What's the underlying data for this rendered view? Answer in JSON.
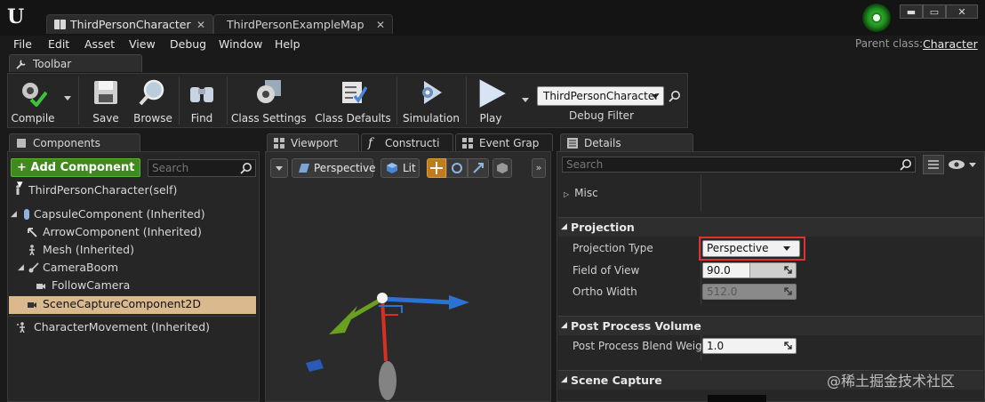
{
  "window": {
    "tabs": [
      {
        "label": "ThirdPersonCharacter",
        "active": true
      },
      {
        "label": "ThirdPersonExampleMap",
        "active": false
      }
    ],
    "controls": {
      "minimize": "▬",
      "maximize": "▭",
      "close": "✕"
    }
  },
  "menu": {
    "items": [
      "File",
      "Edit",
      "Asset",
      "View",
      "Debug",
      "Window",
      "Help"
    ],
    "parent_class_label": "Parent class:",
    "parent_class_value": "Character"
  },
  "toolbar": {
    "tab_label": "Toolbar",
    "buttons": [
      {
        "label": "Compile",
        "icon": "compile-gear-check-icon"
      },
      {
        "label": "Save",
        "icon": "save-disk-icon"
      },
      {
        "label": "Browse",
        "icon": "browse-magnifier-icon"
      },
      {
        "label": "Find",
        "icon": "find-binoculars-icon"
      },
      {
        "label": "Class Settings",
        "icon": "class-settings-gear-icon"
      },
      {
        "label": "Class Defaults",
        "icon": "class-defaults-checklist-icon"
      },
      {
        "label": "Simulation",
        "icon": "simulation-icon"
      },
      {
        "label": "Play",
        "icon": "play-triangle-icon"
      }
    ],
    "debug_filter": {
      "value": "ThirdPersonCharacter",
      "label": "Debug Filter"
    }
  },
  "components": {
    "tab_label": "Components",
    "add_button": "+ Add Component ▾",
    "search_placeholder": "Search",
    "tree": [
      {
        "label": "ThirdPersonCharacter(self)"
      },
      {
        "label": "CapsuleComponent (Inherited)"
      },
      {
        "label": "ArrowComponent (Inherited)"
      },
      {
        "label": "Mesh (Inherited)"
      },
      {
        "label": "CameraBoom"
      },
      {
        "label": "FollowCamera"
      },
      {
        "label": "SceneCaptureComponent2D",
        "selected": true
      },
      {
        "label": "CharacterMovement (Inherited)"
      }
    ]
  },
  "viewport": {
    "tabs": [
      "Viewport",
      "Constructi",
      "Event Grap"
    ],
    "perspective_label": "Perspective",
    "lit_label": "Lit"
  },
  "details": {
    "tab_label": "Details",
    "search_placeholder": "Search",
    "misc_label": "Misc",
    "projection": {
      "header": "Projection",
      "projection_type_label": "Projection Type",
      "projection_type_value": "Perspective",
      "fov_label": "Field of View",
      "fov_value": "90.0",
      "fov_fill": 0.5,
      "ortho_label": "Ortho Width",
      "ortho_value": "512.0"
    },
    "post_process": {
      "header": "Post Process Volume",
      "blend_label": "Post Process Blend Weight",
      "blend_value": "1.0"
    },
    "scene_capture": {
      "header": "Scene Capture"
    }
  },
  "watermark": "@稀土掘金技术社区",
  "colors": {
    "add_component_green": "#3e8a1e",
    "selection_tan": "#d9b98d",
    "highlight_red": "#e03030",
    "gizmo_blue": "#2a72d8",
    "gizmo_green": "#6aa020",
    "gizmo_red": "#d83020"
  }
}
